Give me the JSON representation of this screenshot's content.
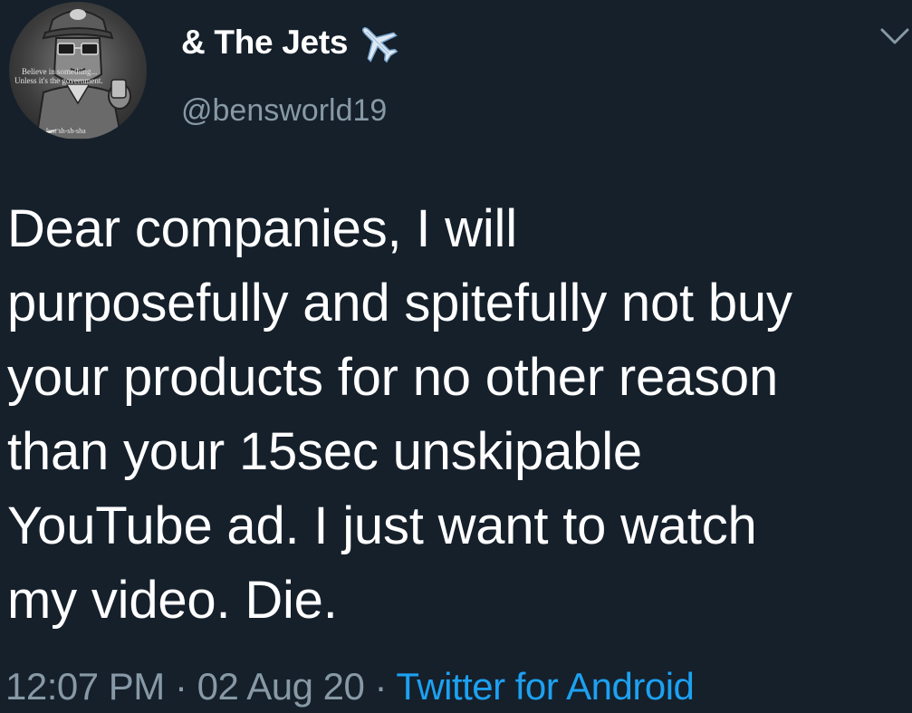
{
  "tweet": {
    "avatar": {
      "text_line1": "Believe in something...",
      "text_line2": "Unless it's the government.",
      "text_line3": "Just sh-sh-sha"
    },
    "display_name": "& The Jets",
    "name_emoji_icon": "airplane-icon",
    "handle": "@bensworld19",
    "menu_icon": "chevron-down-icon",
    "body_lines": [
      "Dear companies, I will",
      "purposefully and spitefully not buy",
      "your products for no other reason",
      "than your 15sec unskipable",
      "YouTube ad. I just want to watch",
      "my video. Die."
    ],
    "time": "12:07 PM",
    "separator": "·",
    "date": "02 Aug 20",
    "source": "Twitter for Android"
  },
  "colors": {
    "background": "#15202b",
    "text": "#ffffff",
    "secondary_text": "#8899a6",
    "link": "#1da1f2"
  }
}
